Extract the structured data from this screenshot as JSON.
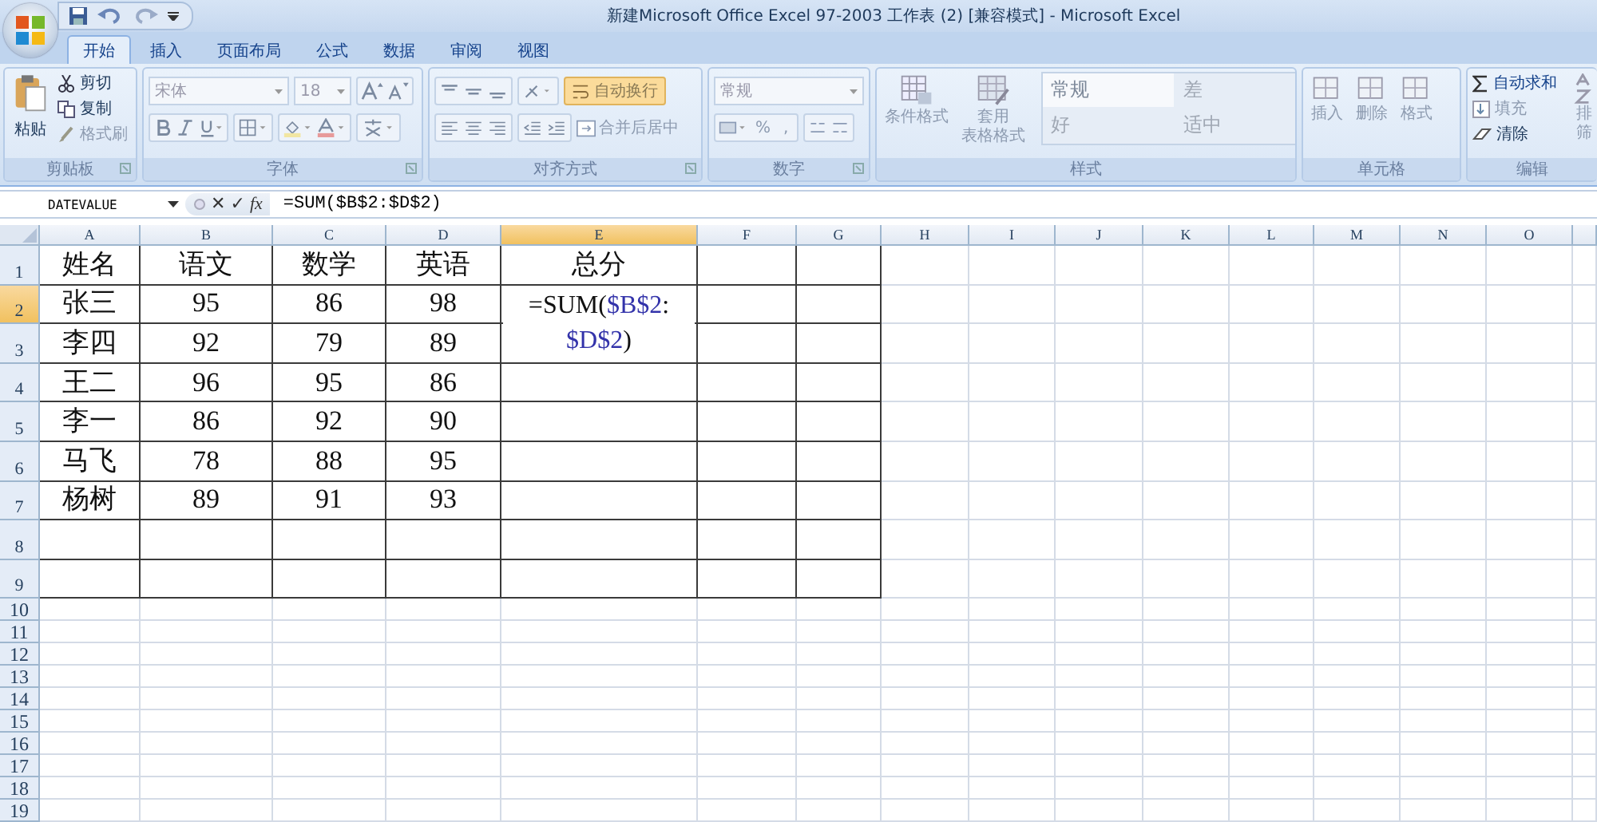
{
  "title_bar": {
    "title": "新建Microsoft Office Excel 97-2003 工作表 (2)  [兼容模式] - Microsoft Excel"
  },
  "ribbon_tabs": [
    {
      "label": "开始",
      "selected": true
    },
    {
      "label": "插入",
      "selected": false
    },
    {
      "label": "页面布局",
      "selected": false
    },
    {
      "label": "公式",
      "selected": false
    },
    {
      "label": "数据",
      "selected": false
    },
    {
      "label": "审阅",
      "selected": false
    },
    {
      "label": "视图",
      "selected": false
    }
  ],
  "ribbon": {
    "clipboard": {
      "group_label": "剪贴板",
      "paste": "粘贴",
      "cut": "剪切",
      "copy": "复制",
      "format_painter": "格式刷"
    },
    "font": {
      "group_label": "字体",
      "font_name": "宋体",
      "font_size": "18"
    },
    "alignment": {
      "group_label": "对齐方式",
      "wrap_text": {
        "label": "自动换行",
        "on": true
      },
      "merge_center": "合并后居中"
    },
    "number": {
      "group_label": "数字",
      "format": "常规",
      "percent": "%",
      "comma": ","
    },
    "styles": {
      "group_label": "样式",
      "conditional_formatting": "条件格式",
      "table_format": [
        "套用",
        "表格格式"
      ],
      "cell_styles": [
        {
          "label": "常规",
          "selected": true
        },
        {
          "label": "差",
          "selected": false
        },
        {
          "label": "好",
          "selected": false
        },
        {
          "label": "适中",
          "selected": false
        }
      ]
    },
    "cells": {
      "group_label": "单元格",
      "buttons": [
        "插入",
        "删除",
        "格式"
      ]
    },
    "editing": {
      "group_label": "编辑",
      "autosum": "自动求和",
      "fill": "填充",
      "clear": "清除",
      "sort_filter": [
        "排",
        "筛"
      ]
    }
  },
  "formula_bar": {
    "name_box": "DATEVALUE",
    "cancel": "✕",
    "enter": "✓",
    "function_button": "fx",
    "formula": "=SUM($B$2:$D$2)"
  },
  "sheet": {
    "columns": [
      {
        "label": "A",
        "selected": false
      },
      {
        "label": "B",
        "selected": false
      },
      {
        "label": "C",
        "selected": false
      },
      {
        "label": "D",
        "selected": false
      },
      {
        "label": "E",
        "selected": true
      },
      {
        "label": "F",
        "selected": false
      },
      {
        "label": "G",
        "selected": false
      },
      {
        "label": "H",
        "selected": false
      },
      {
        "label": "I",
        "selected": false
      },
      {
        "label": "J",
        "selected": false
      },
      {
        "label": "K",
        "selected": false
      },
      {
        "label": "L",
        "selected": false
      },
      {
        "label": "M",
        "selected": false
      },
      {
        "label": "N",
        "selected": false
      },
      {
        "label": "O",
        "selected": false
      }
    ],
    "rows": [
      {
        "header": "1",
        "selected": false,
        "bordered": true,
        "cells": [
          "姓名",
          "语文",
          "数学",
          "英语",
          "总分"
        ]
      },
      {
        "header": "2",
        "selected": true,
        "bordered": true,
        "cells": [
          "张三",
          "95",
          "86",
          "98"
        ]
      },
      {
        "header": "3",
        "selected": false,
        "bordered": true,
        "cells": [
          "李四",
          "92",
          "79",
          "89"
        ]
      },
      {
        "header": "4",
        "selected": false,
        "bordered": true,
        "cells": [
          "王二",
          "96",
          "95",
          "86"
        ]
      },
      {
        "header": "5",
        "selected": false,
        "bordered": true,
        "cells": [
          "李一",
          "86",
          "92",
          "90"
        ]
      },
      {
        "header": "6",
        "selected": false,
        "bordered": true,
        "cells": [
          "马飞",
          "78",
          "88",
          "95"
        ]
      },
      {
        "header": "7",
        "selected": false,
        "bordered": true,
        "cells": [
          "杨树",
          "89",
          "91",
          "93"
        ]
      },
      {
        "header": "8",
        "selected": false,
        "bordered": true,
        "cells": []
      },
      {
        "header": "9",
        "selected": false,
        "bordered": true,
        "cells": []
      },
      {
        "header": "10",
        "selected": false,
        "bordered": false,
        "cells": []
      },
      {
        "header": "11",
        "selected": false,
        "bordered": false,
        "cells": []
      },
      {
        "header": "12",
        "selected": false,
        "bordered": false,
        "cells": []
      },
      {
        "header": "13",
        "selected": false,
        "bordered": false,
        "cells": []
      },
      {
        "header": "14",
        "selected": false,
        "bordered": false,
        "cells": []
      },
      {
        "header": "15",
        "selected": false,
        "bordered": false,
        "cells": []
      },
      {
        "header": "16",
        "selected": false,
        "bordered": false,
        "cells": []
      },
      {
        "header": "17",
        "selected": false,
        "bordered": false,
        "cells": []
      },
      {
        "header": "18",
        "selected": false,
        "bordered": false,
        "cells": []
      },
      {
        "header": "19",
        "selected": false,
        "bordered": false,
        "cells": []
      }
    ],
    "edit_cell": {
      "parts": [
        {
          "text": "=SUM(",
          "kind": "plain"
        },
        {
          "text": "$B$2",
          "kind": "reference"
        },
        {
          "text": ":",
          "kind": "plain"
        },
        {
          "text": "$D$2",
          "kind": "reference"
        },
        {
          "text": ")",
          "kind": "plain"
        }
      ]
    }
  }
}
